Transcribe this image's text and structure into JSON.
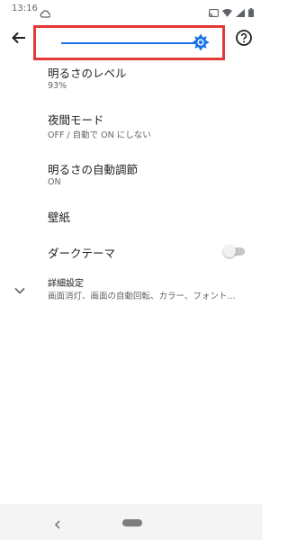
{
  "status": {
    "time": "13:16",
    "icons": [
      "cloud-icon",
      "cast-icon",
      "wifi-icon",
      "signal-icon",
      "battery-icon"
    ]
  },
  "toolbar": {
    "back_icon": "arrow-back-icon",
    "help_icon": "help-icon"
  },
  "brightness_slider": {
    "level": 0.93,
    "accent": "#1a73e8",
    "highlight": "#e53935"
  },
  "settings": [
    {
      "title": "明るさのレベル",
      "summary": "93%"
    },
    {
      "title": "夜間モード",
      "summary": "OFF / 自動で ON にしない"
    },
    {
      "title": "明るさの自動調節",
      "summary": "ON"
    },
    {
      "title": "壁紙"
    },
    {
      "title": "ダークテーマ",
      "toggle": false
    },
    {
      "title": "詳細設定",
      "summary": "画面消灯、画面の自動回転、カラー、フォント…",
      "icon": "chevron-down-icon"
    }
  ],
  "nav": {
    "back_icon": "nav-back-icon",
    "home_icon": "home-pill-icon"
  }
}
